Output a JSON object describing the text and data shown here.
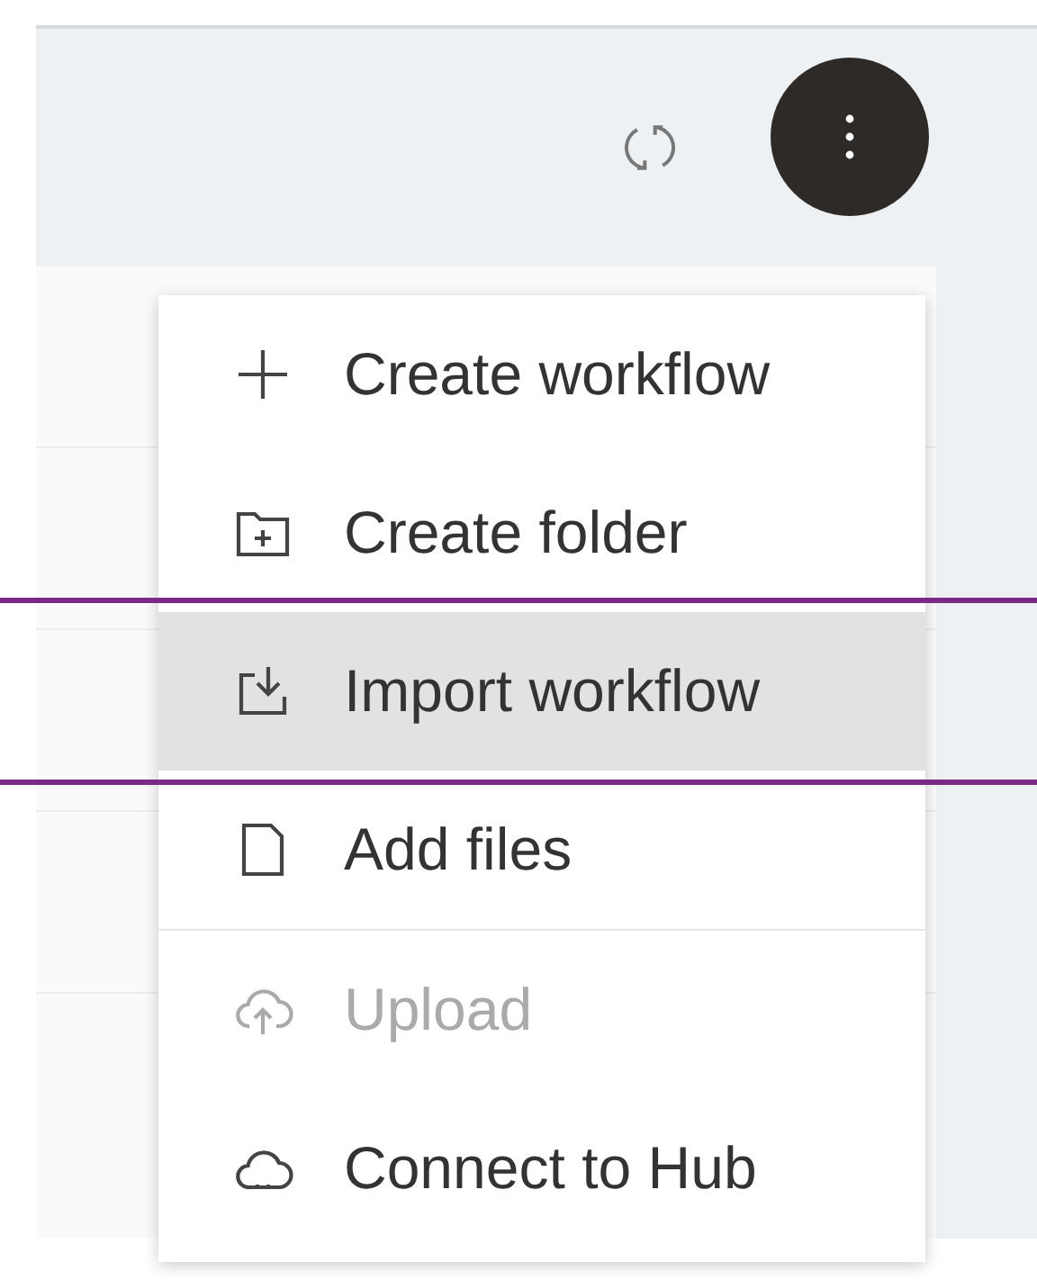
{
  "menu": {
    "items": [
      {
        "label": "Create workflow",
        "kind": "plus",
        "selected": false,
        "disabled": false,
        "divider_above": false
      },
      {
        "label": "Create folder",
        "kind": "folder",
        "selected": false,
        "disabled": false,
        "divider_above": false
      },
      {
        "label": "Import workflow",
        "kind": "import",
        "selected": true,
        "disabled": false,
        "divider_above": false
      },
      {
        "label": "Add files",
        "kind": "file",
        "selected": false,
        "disabled": false,
        "divider_above": false
      },
      {
        "label": "Upload",
        "kind": "upload",
        "selected": false,
        "disabled": true,
        "divider_above": true
      },
      {
        "label": "Connect to Hub",
        "kind": "hub",
        "selected": false,
        "disabled": false,
        "divider_above": false
      }
    ]
  }
}
